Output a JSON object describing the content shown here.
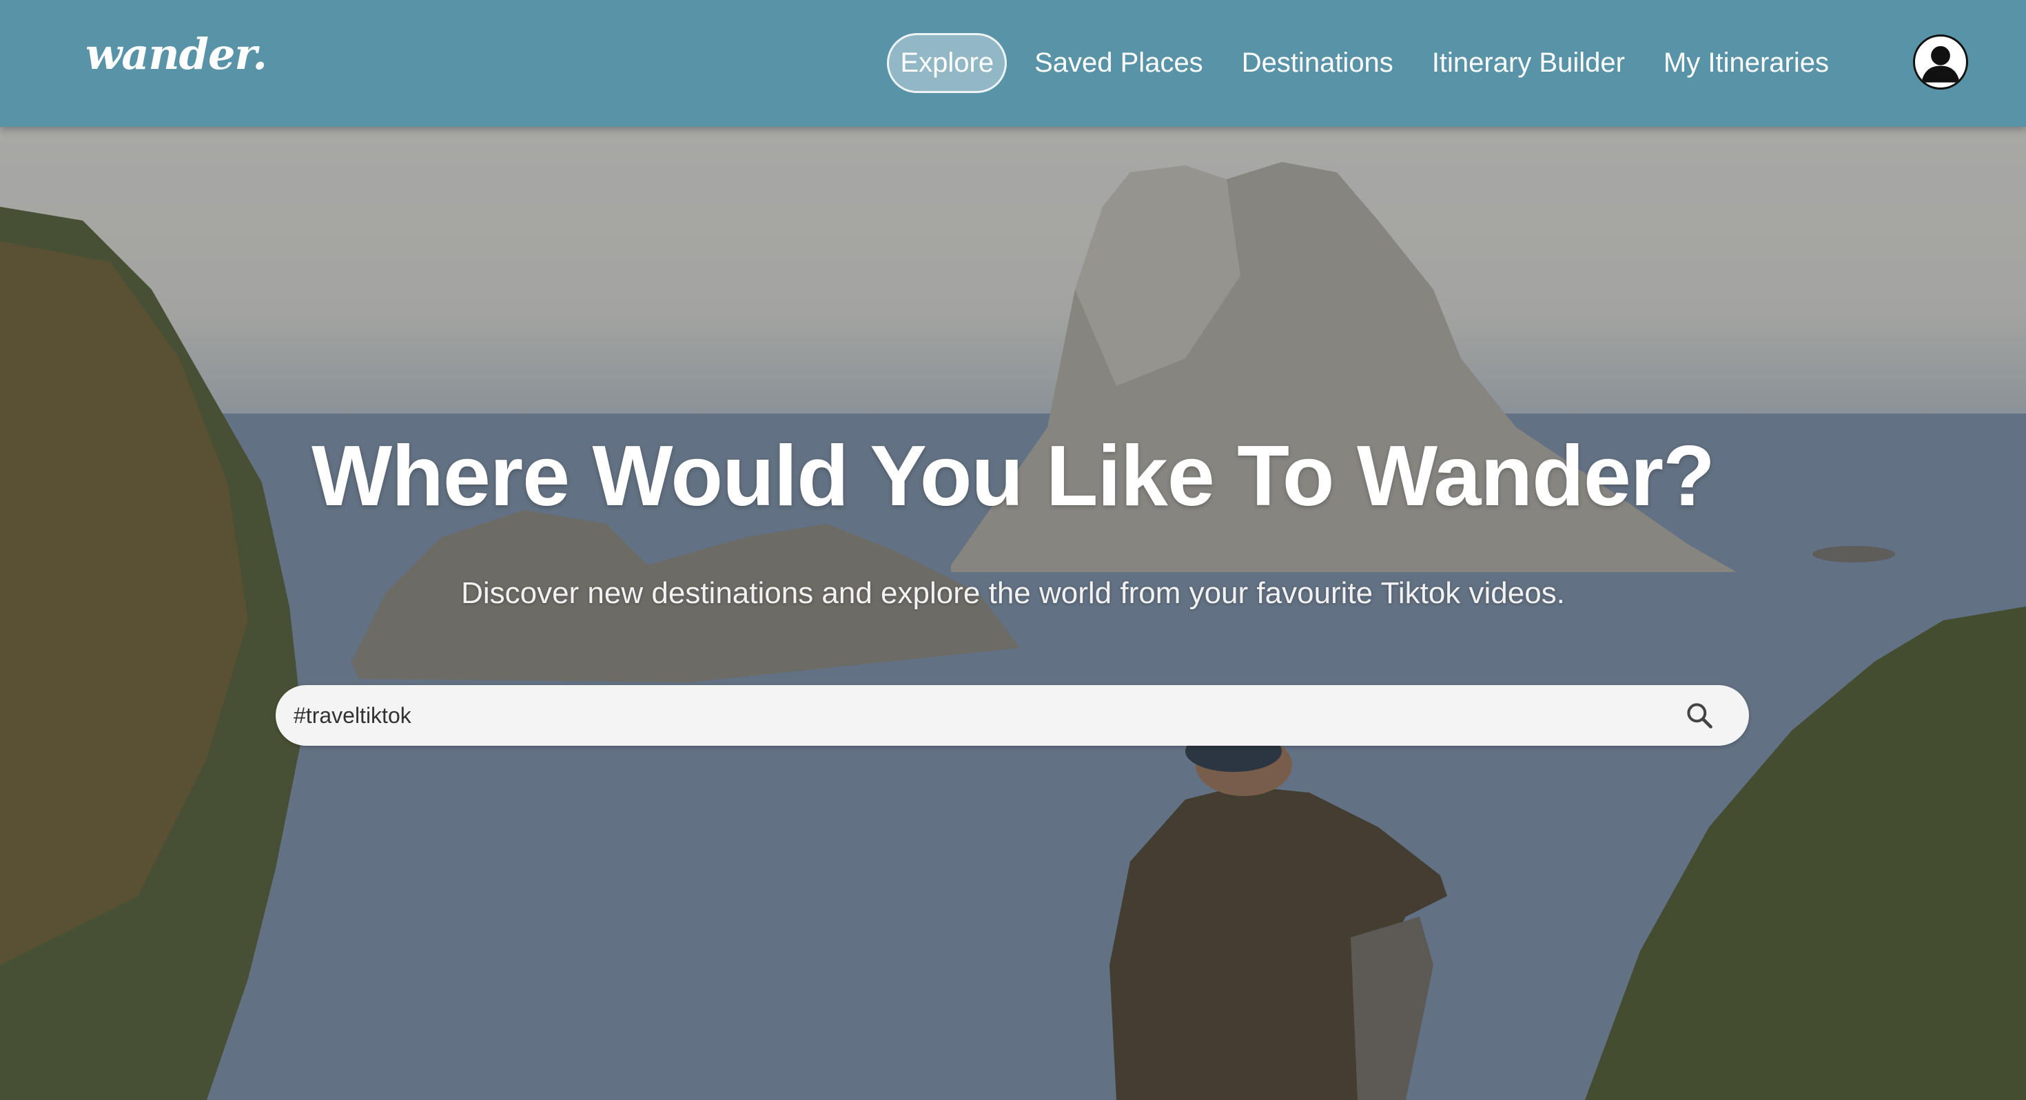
{
  "app": {
    "logo": "wander."
  },
  "nav": {
    "items": [
      {
        "label": "Explore",
        "active": true
      },
      {
        "label": "Saved Places",
        "active": false
      },
      {
        "label": "Destinations",
        "active": false
      },
      {
        "label": "Itinerary Builder",
        "active": false
      },
      {
        "label": "My Itineraries",
        "active": false
      }
    ],
    "avatar_icon": "user-account-icon"
  },
  "hero": {
    "title": "Where Would You Like To Wander?",
    "subtitle": "Discover new destinations and explore the world from your favourite Tiktok videos.",
    "background": "coastal-rock-island-photo"
  },
  "search": {
    "value": "#traveltiktok",
    "icon": "search-icon"
  },
  "colors": {
    "navbar": "#5893a7",
    "search_bg": "#f4f4f4",
    "text_light": "#ffffff"
  }
}
